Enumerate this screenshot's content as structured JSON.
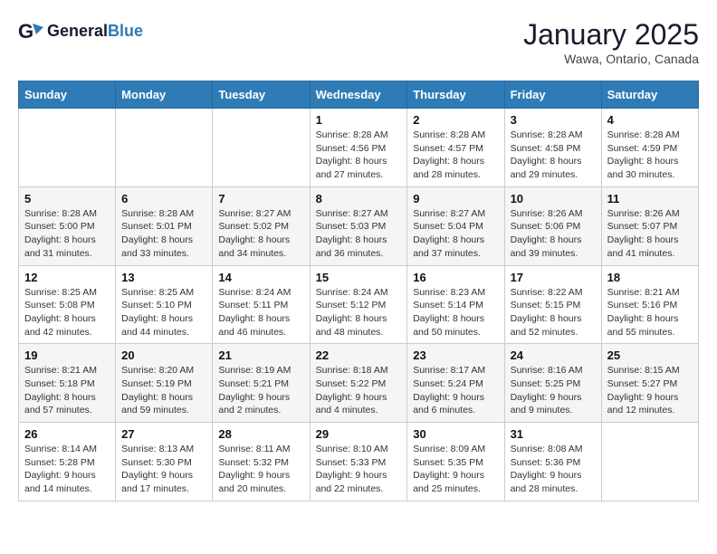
{
  "header": {
    "logo_general": "General",
    "logo_blue": "Blue",
    "month_title": "January 2025",
    "location": "Wawa, Ontario, Canada"
  },
  "weekdays": [
    "Sunday",
    "Monday",
    "Tuesday",
    "Wednesday",
    "Thursday",
    "Friday",
    "Saturday"
  ],
  "weeks": [
    [
      {
        "day": "",
        "info": ""
      },
      {
        "day": "",
        "info": ""
      },
      {
        "day": "",
        "info": ""
      },
      {
        "day": "1",
        "info": "Sunrise: 8:28 AM\nSunset: 4:56 PM\nDaylight: 8 hours\nand 27 minutes."
      },
      {
        "day": "2",
        "info": "Sunrise: 8:28 AM\nSunset: 4:57 PM\nDaylight: 8 hours\nand 28 minutes."
      },
      {
        "day": "3",
        "info": "Sunrise: 8:28 AM\nSunset: 4:58 PM\nDaylight: 8 hours\nand 29 minutes."
      },
      {
        "day": "4",
        "info": "Sunrise: 8:28 AM\nSunset: 4:59 PM\nDaylight: 8 hours\nand 30 minutes."
      }
    ],
    [
      {
        "day": "5",
        "info": "Sunrise: 8:28 AM\nSunset: 5:00 PM\nDaylight: 8 hours\nand 31 minutes."
      },
      {
        "day": "6",
        "info": "Sunrise: 8:28 AM\nSunset: 5:01 PM\nDaylight: 8 hours\nand 33 minutes."
      },
      {
        "day": "7",
        "info": "Sunrise: 8:27 AM\nSunset: 5:02 PM\nDaylight: 8 hours\nand 34 minutes."
      },
      {
        "day": "8",
        "info": "Sunrise: 8:27 AM\nSunset: 5:03 PM\nDaylight: 8 hours\nand 36 minutes."
      },
      {
        "day": "9",
        "info": "Sunrise: 8:27 AM\nSunset: 5:04 PM\nDaylight: 8 hours\nand 37 minutes."
      },
      {
        "day": "10",
        "info": "Sunrise: 8:26 AM\nSunset: 5:06 PM\nDaylight: 8 hours\nand 39 minutes."
      },
      {
        "day": "11",
        "info": "Sunrise: 8:26 AM\nSunset: 5:07 PM\nDaylight: 8 hours\nand 41 minutes."
      }
    ],
    [
      {
        "day": "12",
        "info": "Sunrise: 8:25 AM\nSunset: 5:08 PM\nDaylight: 8 hours\nand 42 minutes."
      },
      {
        "day": "13",
        "info": "Sunrise: 8:25 AM\nSunset: 5:10 PM\nDaylight: 8 hours\nand 44 minutes."
      },
      {
        "day": "14",
        "info": "Sunrise: 8:24 AM\nSunset: 5:11 PM\nDaylight: 8 hours\nand 46 minutes."
      },
      {
        "day": "15",
        "info": "Sunrise: 8:24 AM\nSunset: 5:12 PM\nDaylight: 8 hours\nand 48 minutes."
      },
      {
        "day": "16",
        "info": "Sunrise: 8:23 AM\nSunset: 5:14 PM\nDaylight: 8 hours\nand 50 minutes."
      },
      {
        "day": "17",
        "info": "Sunrise: 8:22 AM\nSunset: 5:15 PM\nDaylight: 8 hours\nand 52 minutes."
      },
      {
        "day": "18",
        "info": "Sunrise: 8:21 AM\nSunset: 5:16 PM\nDaylight: 8 hours\nand 55 minutes."
      }
    ],
    [
      {
        "day": "19",
        "info": "Sunrise: 8:21 AM\nSunset: 5:18 PM\nDaylight: 8 hours\nand 57 minutes."
      },
      {
        "day": "20",
        "info": "Sunrise: 8:20 AM\nSunset: 5:19 PM\nDaylight: 8 hours\nand 59 minutes."
      },
      {
        "day": "21",
        "info": "Sunrise: 8:19 AM\nSunset: 5:21 PM\nDaylight: 9 hours\nand 2 minutes."
      },
      {
        "day": "22",
        "info": "Sunrise: 8:18 AM\nSunset: 5:22 PM\nDaylight: 9 hours\nand 4 minutes."
      },
      {
        "day": "23",
        "info": "Sunrise: 8:17 AM\nSunset: 5:24 PM\nDaylight: 9 hours\nand 6 minutes."
      },
      {
        "day": "24",
        "info": "Sunrise: 8:16 AM\nSunset: 5:25 PM\nDaylight: 9 hours\nand 9 minutes."
      },
      {
        "day": "25",
        "info": "Sunrise: 8:15 AM\nSunset: 5:27 PM\nDaylight: 9 hours\nand 12 minutes."
      }
    ],
    [
      {
        "day": "26",
        "info": "Sunrise: 8:14 AM\nSunset: 5:28 PM\nDaylight: 9 hours\nand 14 minutes."
      },
      {
        "day": "27",
        "info": "Sunrise: 8:13 AM\nSunset: 5:30 PM\nDaylight: 9 hours\nand 17 minutes."
      },
      {
        "day": "28",
        "info": "Sunrise: 8:11 AM\nSunset: 5:32 PM\nDaylight: 9 hours\nand 20 minutes."
      },
      {
        "day": "29",
        "info": "Sunrise: 8:10 AM\nSunset: 5:33 PM\nDaylight: 9 hours\nand 22 minutes."
      },
      {
        "day": "30",
        "info": "Sunrise: 8:09 AM\nSunset: 5:35 PM\nDaylight: 9 hours\nand 25 minutes."
      },
      {
        "day": "31",
        "info": "Sunrise: 8:08 AM\nSunset: 5:36 PM\nDaylight: 9 hours\nand 28 minutes."
      },
      {
        "day": "",
        "info": ""
      }
    ]
  ]
}
